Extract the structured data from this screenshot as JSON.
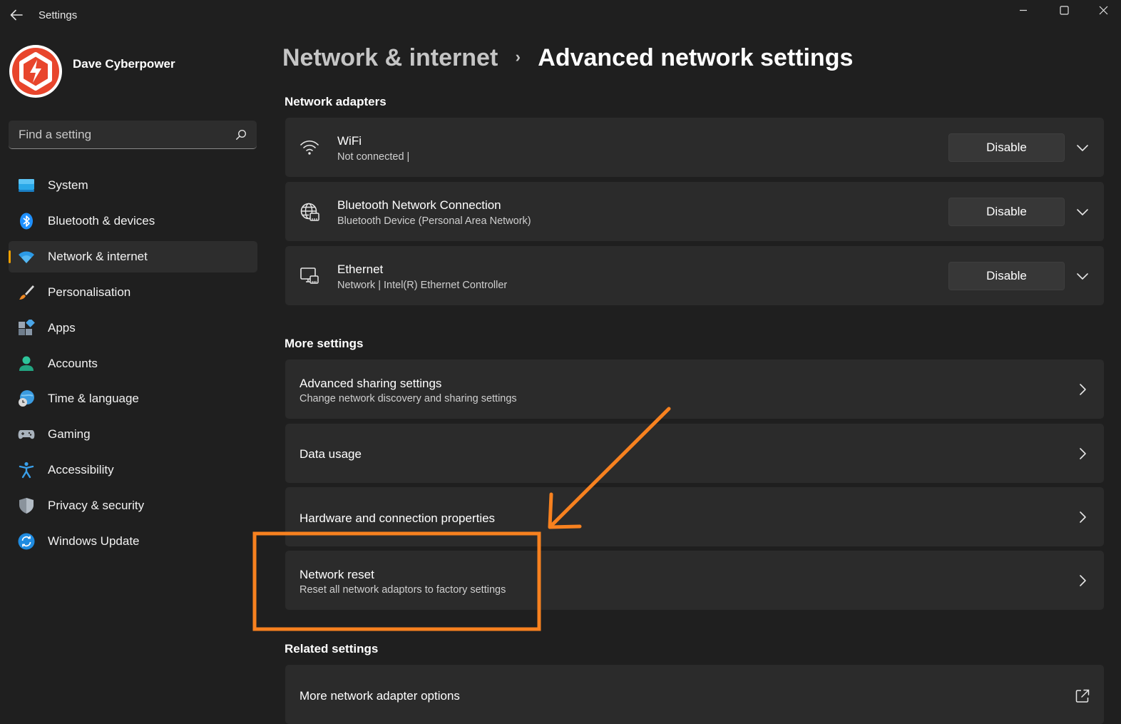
{
  "window": {
    "app_title": "Settings"
  },
  "user": {
    "name": "Dave Cyberpower"
  },
  "search": {
    "placeholder": "Find a setting"
  },
  "sidebar": {
    "items": [
      {
        "label": "System",
        "icon": "monitor-icon",
        "active": false
      },
      {
        "label": "Bluetooth & devices",
        "icon": "bluetooth-icon",
        "active": false
      },
      {
        "label": "Network & internet",
        "icon": "wifi-icon",
        "active": true
      },
      {
        "label": "Personalisation",
        "icon": "brush-icon",
        "active": false
      },
      {
        "label": "Apps",
        "icon": "apps-icon",
        "active": false
      },
      {
        "label": "Accounts",
        "icon": "person-icon",
        "active": false
      },
      {
        "label": "Time & language",
        "icon": "globe-clock-icon",
        "active": false
      },
      {
        "label": "Gaming",
        "icon": "gamepad-icon",
        "active": false
      },
      {
        "label": "Accessibility",
        "icon": "accessibility-icon",
        "active": false
      },
      {
        "label": "Privacy & security",
        "icon": "shield-icon",
        "active": false
      },
      {
        "label": "Windows Update",
        "icon": "update-icon",
        "active": false
      }
    ]
  },
  "breadcrumb": {
    "parent": "Network & internet",
    "separator": "›",
    "current": "Advanced network settings"
  },
  "sections": {
    "adapters_title": "Network adapters",
    "more_title": "More settings",
    "related_title": "Related settings"
  },
  "adapters": [
    {
      "name": "WiFi",
      "status": "Not connected |",
      "button": "Disable",
      "icon": "wifi-icon"
    },
    {
      "name": "Bluetooth Network Connection",
      "status": "Bluetooth Device (Personal Area Network)",
      "button": "Disable",
      "icon": "globe-network-icon"
    },
    {
      "name": "Ethernet",
      "status": "Network | Intel(R) Ethernet Controller",
      "button": "Disable",
      "icon": "ethernet-icon"
    }
  ],
  "more_settings": [
    {
      "title": "Advanced sharing settings",
      "subtitle": "Change network discovery and sharing settings"
    },
    {
      "title": "Data usage",
      "subtitle": ""
    },
    {
      "title": "Hardware and connection properties",
      "subtitle": ""
    },
    {
      "title": "Network reset",
      "subtitle": "Reset all network adaptors to factory settings"
    }
  ],
  "related_settings": [
    {
      "title": "More network adapter options",
      "icon": "external-link-icon"
    }
  ],
  "colors": {
    "background": "#1f1f1f",
    "card": "#2b2b2b",
    "accent_indicator": "#f0a000",
    "annotation": "#f7811f",
    "logo_red": "#e8452c"
  }
}
